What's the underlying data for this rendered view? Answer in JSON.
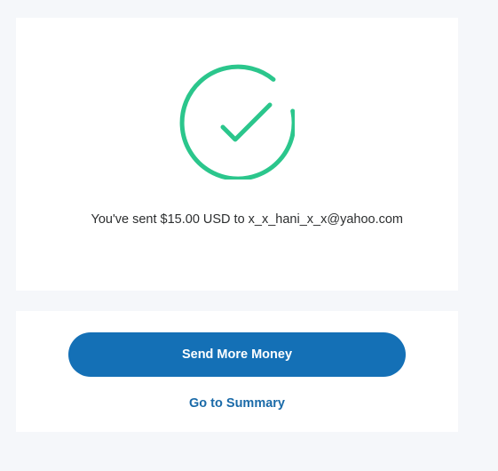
{
  "confirmation": {
    "icon": "check-circle-icon",
    "message": "You've sent $15.00 USD to x_x_hani_x_x@yahoo.com"
  },
  "actions": {
    "send_more_label": "Send More Money",
    "summary_link_label": "Go to Summary"
  },
  "colors": {
    "page_background": "#f5f7fa",
    "success_green": "#2bc68c",
    "primary_blue": "#1470b6",
    "link_blue": "#1a6aa8",
    "text": "#2c2e2f"
  }
}
